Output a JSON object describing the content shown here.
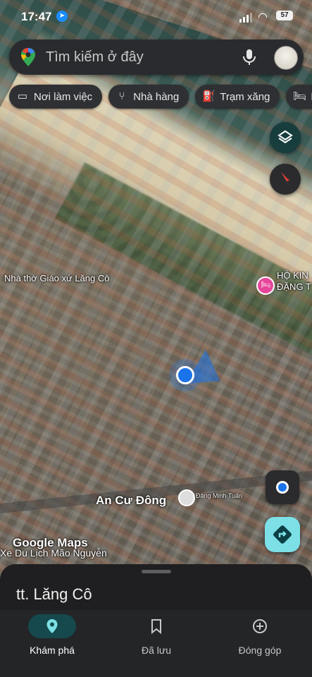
{
  "status_bar": {
    "time": "17:47",
    "battery": "57"
  },
  "search": {
    "placeholder": "Tìm kiếm ở đây"
  },
  "chips": [
    {
      "label": "Nơi làm việc",
      "icon": "briefcase-icon"
    },
    {
      "label": "Nhà hàng",
      "icon": "restaurant-icon"
    },
    {
      "label": "Trạm xăng",
      "icon": "gas-station-icon"
    },
    {
      "label": "K",
      "icon": "hotel-bed-icon"
    }
  ],
  "map": {
    "labels": {
      "church": "Nhà thờ Giáo xứ Lăng Cô",
      "hotel_line1": "HỘ KIN",
      "hotel_line2": "ĐẶNG T",
      "street": "An Cư Đông",
      "person": "Đặng Minh Tuấn",
      "attribution": "Google Maps",
      "shop": "Xe Du Lịch Mão Nguyễn"
    },
    "imagery": "satellite"
  },
  "sheet": {
    "title": "tt. Lăng Cô"
  },
  "bottom_nav": {
    "explore": "Khám phá",
    "saved": "Đã lưu",
    "contribute": "Đóng góp",
    "active": "explore"
  },
  "colors": {
    "accent": "#15494d",
    "directions": "#7ce0e6",
    "hotel_pin": "#e6459a",
    "location_dot": "#1a73e8"
  }
}
